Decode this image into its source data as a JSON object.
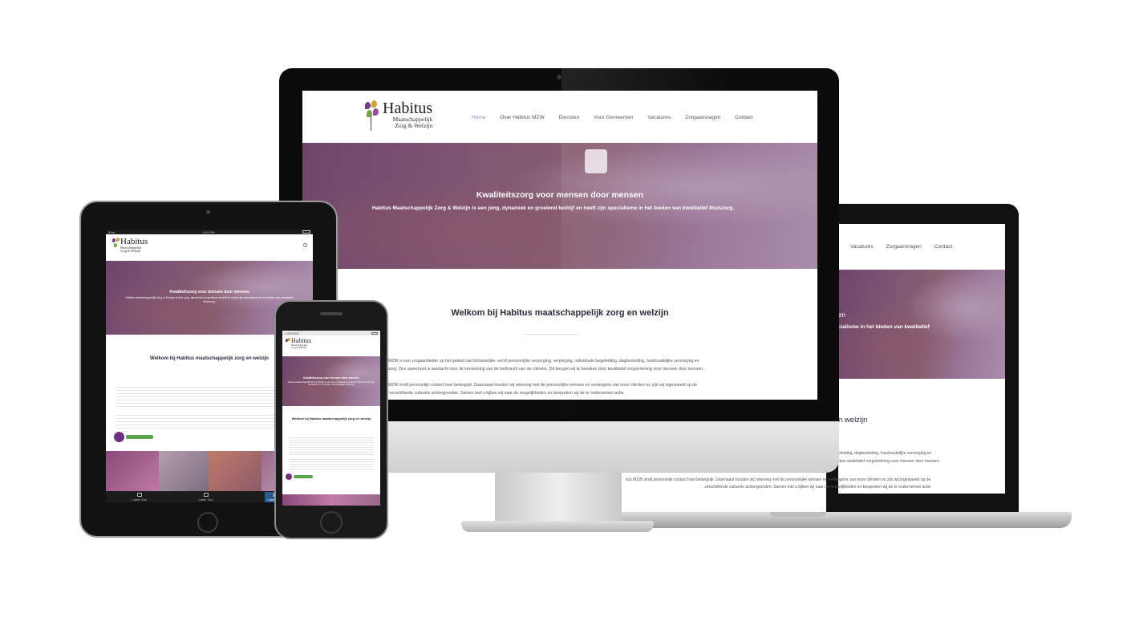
{
  "site": {
    "logo": {
      "name": "Habitus",
      "line1": "Maatschappelijk",
      "line2": "Zorg & Welzijn"
    },
    "nav": [
      "Home",
      "Over Habitus MZW",
      "Diensten",
      "Voor Gemeenten",
      "Vacatures",
      "Zorgaanvragen",
      "Contact"
    ],
    "hero_title": "Kwaliteitszorg voor mensen door mensen",
    "hero_sub": "Habitus Maatschappelijk Zorg & Welzijn is een jong, dynamiek en groeiend bedrijf en heeft zijn specialisme in het bieden van kwalitatief thuiszorg.",
    "welcome_title": "Welkom bij Habitus maatschappelijk zorg en welzijn",
    "imac_p1_l1": "MZW is een zorgaanbieder op het gebied van lichamelijke- en/of persoonlijke verzorging, verpleging, individuele begeleiding, dagbesteding, huishoudelijke verzorging en",
    "imac_p1_l2": "zorg. Ons speerpunt is aandacht voor de versterking van de leefkracht van de cliënten. Dit beogen wij te bereiken door kwalitatief zorgverlening voor mensen door mensen.",
    "imac_p2_l1": "MZW vindt persoonlijk contact heel belangrijk. Daarnaast houden wij rekening met de persoonlijke wensen en verlangens van onze cliënten en zijn wij ingespeeld op de",
    "imac_p2_l2": "verschillende culturele achtergronden. Samen met u kijken wij naar de mogelijkheden en bespreken wij de te ondernemen actie."
  },
  "laptop": {
    "nav": [
      "Vacatures",
      "Zorgaanvragen",
      "Contact"
    ],
    "hero_fragment_a": "en",
    "hero_fragment_b": "cialisme in het bieden van kwalitatief",
    "welcome_fragment": "n welzijn",
    "p1_l1": "eleiding, dagbesteding, huishoudelijke verzorging en",
    "p1_l2": "door kwalitatief zorgverlening voor mensen door mensen.",
    "p2_l1": "itus MZW vindt persoonlijk contact heel belangrijk. Daarnaast houden wij rekening met de persoonlijke wensen en verlangens van onze cliënten en zijn wij ingespeeld op de",
    "p2_l2": "verschillende culturele achtergronden. Samen met u kijken wij naar de mogelijkheden en bespreken wij de te ondernemen actie."
  },
  "ipad": {
    "status_left": "iPad",
    "status_time": "3:14 PM",
    "tabs": [
      "Label One",
      "Label Two",
      "Label Three"
    ]
  },
  "iphone": {
    "status_left": "CARRIER"
  },
  "colors": {
    "accent": "#9b85b6",
    "brand_purple": "#6d2f80",
    "green": "#5aa54a",
    "hero_tint": "#733c6e"
  },
  "icons": [
    "menu-icon",
    "location-pin-icon",
    "tab-controller-icon",
    "tab-phone-icon",
    "tab-screen-icon"
  ]
}
